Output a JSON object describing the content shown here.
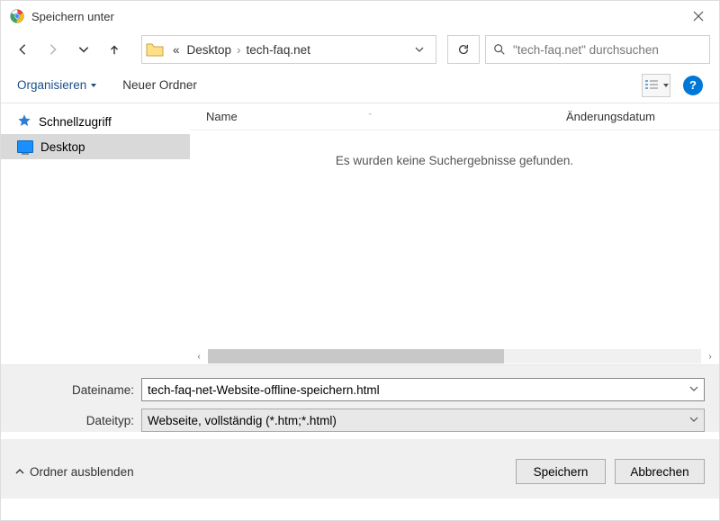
{
  "title": "Speichern unter",
  "breadcrumb": {
    "ell": "«",
    "seg1": "Desktop",
    "seg2": "tech-faq.net"
  },
  "search_placeholder": "\"tech-faq.net\" durchsuchen",
  "toolbar": {
    "organize": "Organisieren",
    "new_folder": "Neuer Ordner",
    "help": "?"
  },
  "sidebar": {
    "quick": "Schnellzugriff",
    "desktop": "Desktop"
  },
  "columns": {
    "name": "Name",
    "date": "Änderungsdatum"
  },
  "empty_msg": "Es wurden keine Suchergebnisse gefunden.",
  "form": {
    "filename_label": "Dateiname:",
    "filename_value": "tech-faq-net-Website-offline-speichern.html",
    "filetype_label": "Dateityp:",
    "filetype_value": "Webseite, vollständig (*.htm;*.html)"
  },
  "hide_folders": "Ordner ausblenden",
  "buttons": {
    "save": "Speichern",
    "cancel": "Abbrechen"
  }
}
